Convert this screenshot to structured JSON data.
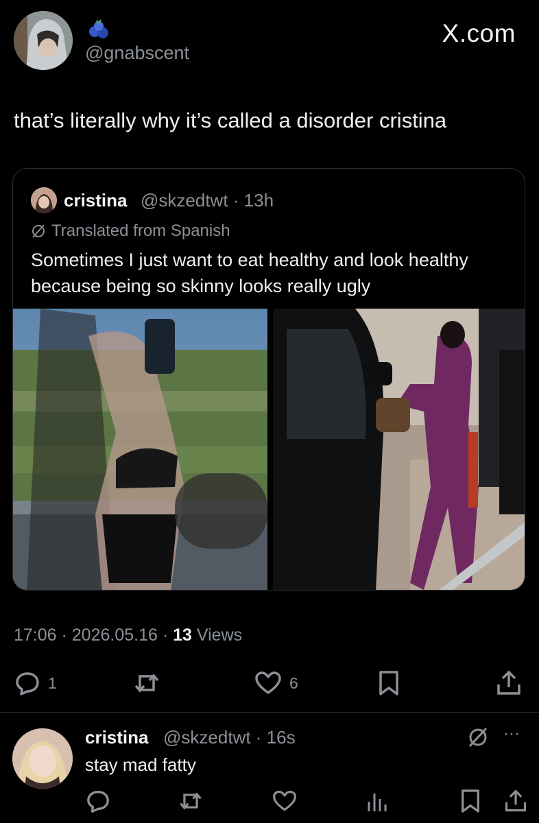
{
  "post": {
    "handle": "@gnabscent",
    "brand": "X.com",
    "text": "that’s literally why it’s called a disorder cristina",
    "meta_time": "17:06 · 2026.05.16 · ",
    "meta_views_count": "13",
    "meta_views_label": " Views",
    "actions": {
      "reply_count": "1",
      "like_count": "6"
    }
  },
  "quote": {
    "name": "cristina",
    "handle_time": "@skzedtwt · 13h",
    "translated_label": "Translated from Spanish",
    "text": "Sometimes I just want to eat healthy and look healthy because being so skinny looks really ugly"
  },
  "reply": {
    "name": "cristina",
    "handle_time": "@skzedtwt · 16s",
    "text": "stay mad fatty",
    "more_label": "···"
  },
  "icons": {
    "reply": "speech-bubble-icon",
    "repost": "repost-arrows-icon",
    "like": "heart-icon",
    "bookmark": "bookmark-icon",
    "share": "share-upload-icon",
    "analytics": "analytics-bars-icon",
    "translate": "translate-slash-icon",
    "badge": "blueberry-badge-icon"
  },
  "colors": {
    "background": "#000000",
    "text_primary": "#e7e9ea",
    "text_secondary": "#8b9196",
    "border": "#2f3336"
  }
}
